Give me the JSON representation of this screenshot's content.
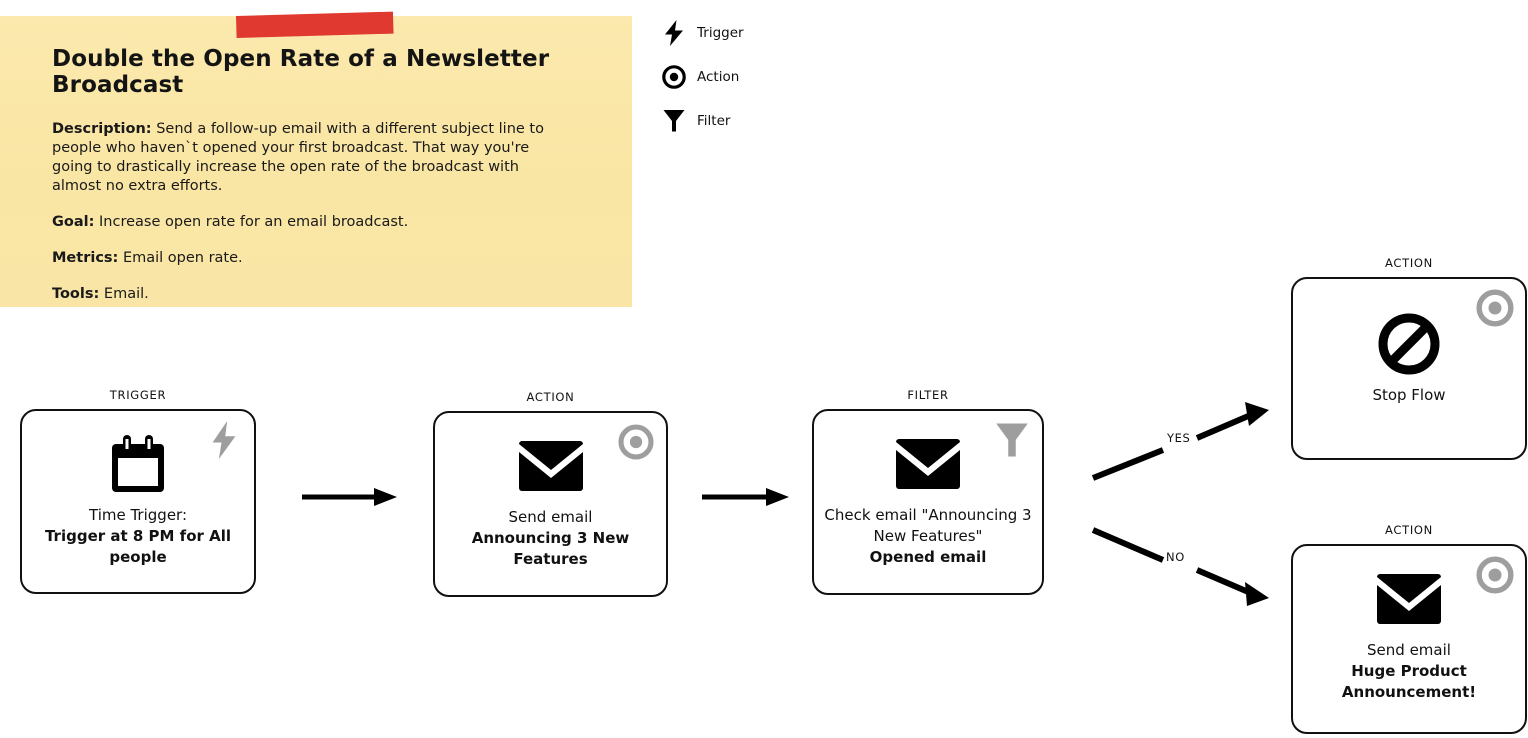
{
  "note": {
    "title": "Double the Open Rate of a Newsletter Broadcast",
    "description_label": "Description:",
    "description_text": " Send a follow-up email with a different subject line to people who haven`t opened your first broadcast. That way you're going to drastically increase the open rate of the broadcast with almost no extra efforts.",
    "goal_label": "Goal:",
    "goal_text": " Increase open rate for an email broadcast.",
    "metrics_label": "Metrics:",
    "metrics_text": " Email open rate.",
    "tools_label": "Tools:",
    "tools_text": " Email.",
    "background_color": "#FAE6A5",
    "tape_color": "#E0392F"
  },
  "legend": {
    "items": [
      {
        "icon": "lightning-bolt-icon",
        "label": "Trigger"
      },
      {
        "icon": "target-circle-icon",
        "label": "Action"
      },
      {
        "icon": "funnel-icon",
        "label": "Filter"
      }
    ]
  },
  "flow": {
    "badge_color": "#9E9E9E",
    "nodes": [
      {
        "id": "trigger",
        "kicker": "TRIGGER",
        "badge": "lightning-bolt-icon",
        "icon": "calendar-icon",
        "line1": "Time Trigger:",
        "line2": "Trigger at 8 PM for All people"
      },
      {
        "id": "send-email-announcing",
        "kicker": "ACTION",
        "badge": "target-circle-icon",
        "icon": "envelope-icon",
        "line1": "Send email",
        "line2": "Announcing 3 New Features"
      },
      {
        "id": "filter-opened-email",
        "kicker": "FILTER",
        "badge": "funnel-icon",
        "icon": "envelope-icon",
        "line1": "Check email \"Announcing 3 New Features\"",
        "line2": "Opened email"
      },
      {
        "id": "stop-flow",
        "kicker": "ACTION",
        "badge": "target-circle-icon",
        "icon": "no-entry-icon",
        "line1": "Stop Flow",
        "line2": ""
      },
      {
        "id": "send-email-huge-product",
        "kicker": "ACTION",
        "badge": "target-circle-icon",
        "icon": "envelope-icon",
        "line1": "Send email",
        "line2": "Huge Product Announcement!"
      }
    ],
    "branches": {
      "yes_label": "YES",
      "no_label": "NO"
    }
  }
}
